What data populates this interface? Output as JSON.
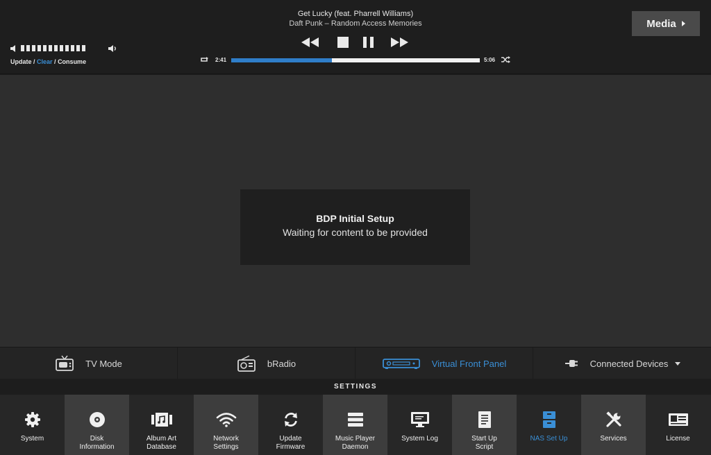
{
  "now_playing": {
    "title": "Get Lucky (feat. Pharrell Williams)",
    "artist_album": "Daft Punk – Random Access Memories",
    "elapsed": "2:41",
    "total": "5:06",
    "progress_fraction": 0.405
  },
  "controls": {
    "rewind": "rewind-icon",
    "stop": "stop-icon",
    "pause": "pause-icon",
    "forward": "fast-forward-icon"
  },
  "volume": {
    "level_ticks": 12
  },
  "queue_links": {
    "update": "Update",
    "sep1": " / ",
    "clear": "Clear",
    "sep2": " / ",
    "consume": "Consume"
  },
  "media_button": {
    "label": "Media"
  },
  "dialog": {
    "title": "BDP Initial Setup",
    "message": "Waiting for content to be provided"
  },
  "modes": [
    {
      "label": "TV Mode",
      "icon": "tv-icon"
    },
    {
      "label": "bRadio",
      "icon": "radio-icon"
    },
    {
      "label": "Virtual Front Panel",
      "icon": "front-panel-icon",
      "active": true
    },
    {
      "label": "Connected Devices",
      "icon": "plug-icon"
    }
  ],
  "settings": {
    "heading": "SETTINGS",
    "items": [
      {
        "label": "System",
        "icon": "gear-icon"
      },
      {
        "label": "Disk\nInformation",
        "icon": "disk-icon"
      },
      {
        "label": "Album Art\nDatabase",
        "icon": "album-art-icon"
      },
      {
        "label": "Network\nSettings",
        "icon": "wifi-icon"
      },
      {
        "label": "Update\nFirmware",
        "icon": "refresh-icon"
      },
      {
        "label": "Music Player\nDaemon",
        "icon": "stack-icon"
      },
      {
        "label": "System Log",
        "icon": "monitor-icon"
      },
      {
        "label": "Start Up\nScript",
        "icon": "document-icon"
      },
      {
        "label": "NAS Set Up",
        "icon": "cabinet-icon",
        "active": true
      },
      {
        "label": "Services",
        "icon": "tools-icon"
      },
      {
        "label": "License",
        "icon": "id-card-icon"
      }
    ]
  },
  "colors": {
    "accent": "#3a8fd6",
    "progress_fill": "#2f7ec9"
  }
}
